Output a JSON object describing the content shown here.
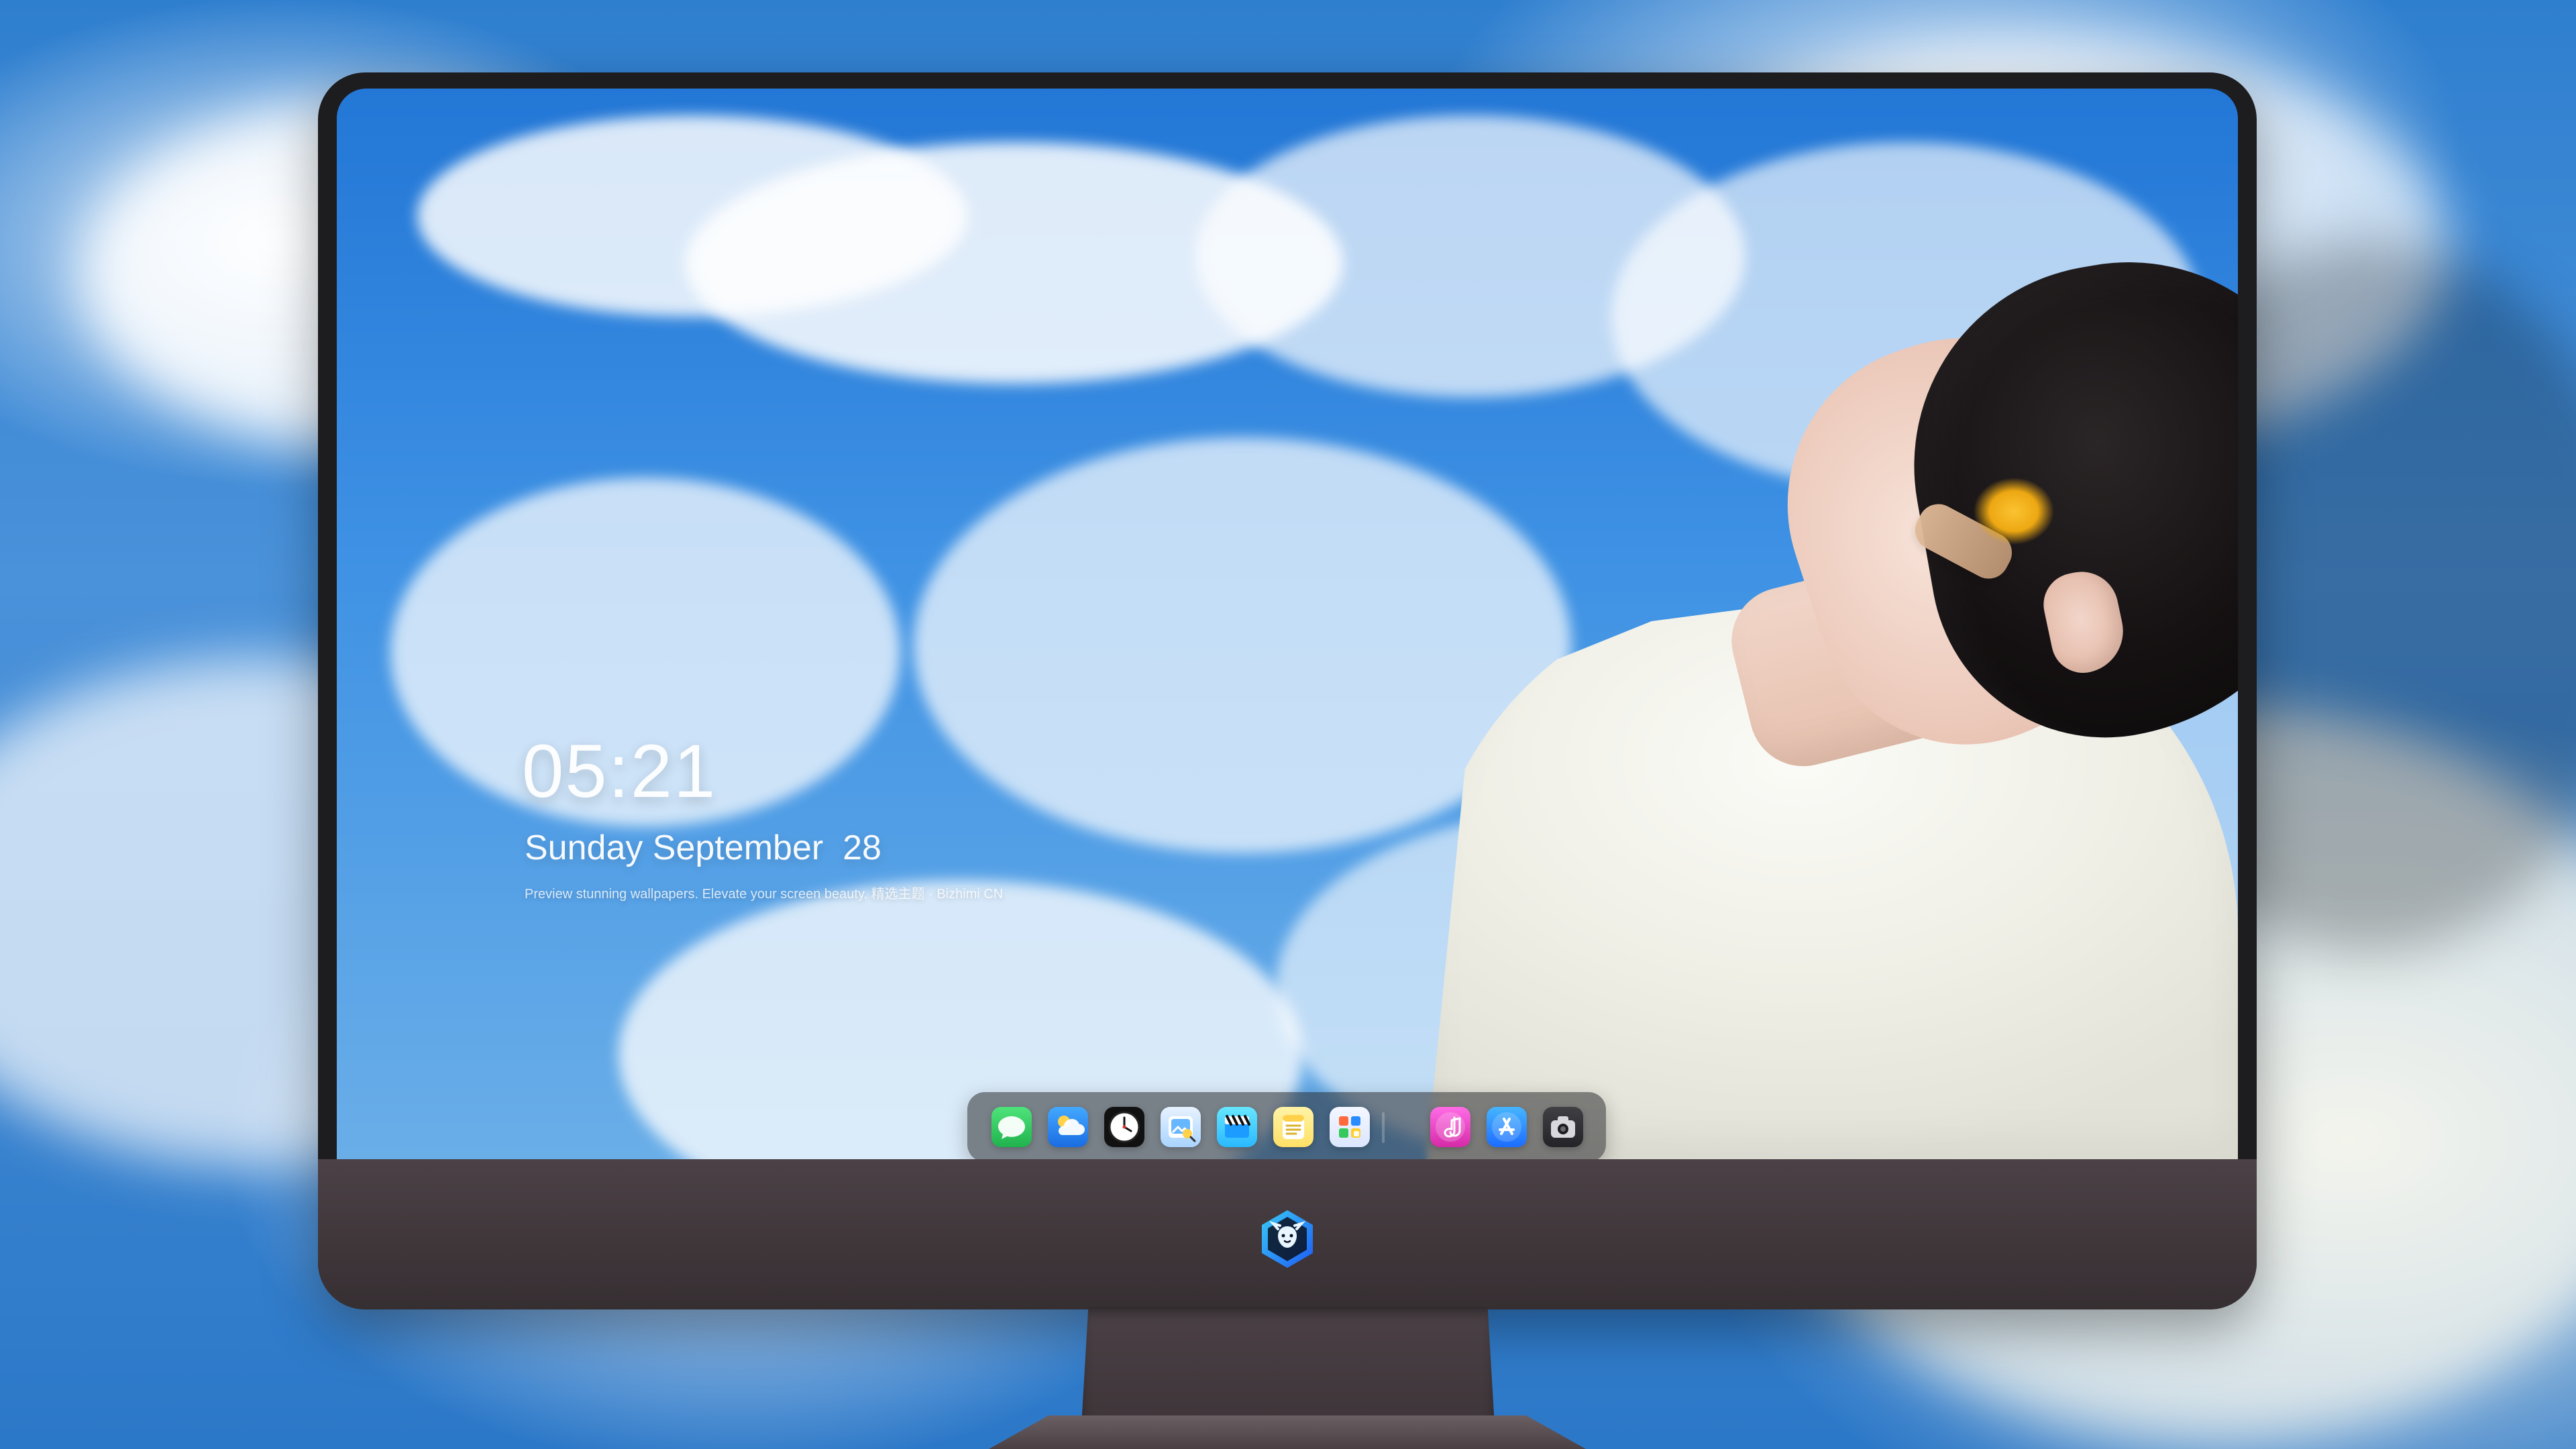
{
  "lockscreen": {
    "time": "05:21",
    "date": "Sunday September  28",
    "caption": "Preview stunning wallpapers. Elevate your screen beauty. 精选主题 · Bizhimi CN"
  },
  "dock": {
    "apps": [
      {
        "name": "messages-icon"
      },
      {
        "name": "weather-icon"
      },
      {
        "name": "clock-icon"
      },
      {
        "name": "preview-icon"
      },
      {
        "name": "clips-icon"
      },
      {
        "name": "notes-icon"
      },
      {
        "name": "photo-browser-icon"
      },
      {
        "name": "music-icon"
      },
      {
        "name": "app-store-icon"
      },
      {
        "name": "camera-icon"
      }
    ]
  },
  "colors": {
    "sky_blue": "#2377d6",
    "bezel": "#1d1c1f",
    "chin": "#4b4146",
    "dock_bg": "rgba(40,40,44,0.55)",
    "accent_pink": "#e04bd6",
    "accent_blue": "#2b8cff",
    "accent_green": "#35c85c"
  }
}
